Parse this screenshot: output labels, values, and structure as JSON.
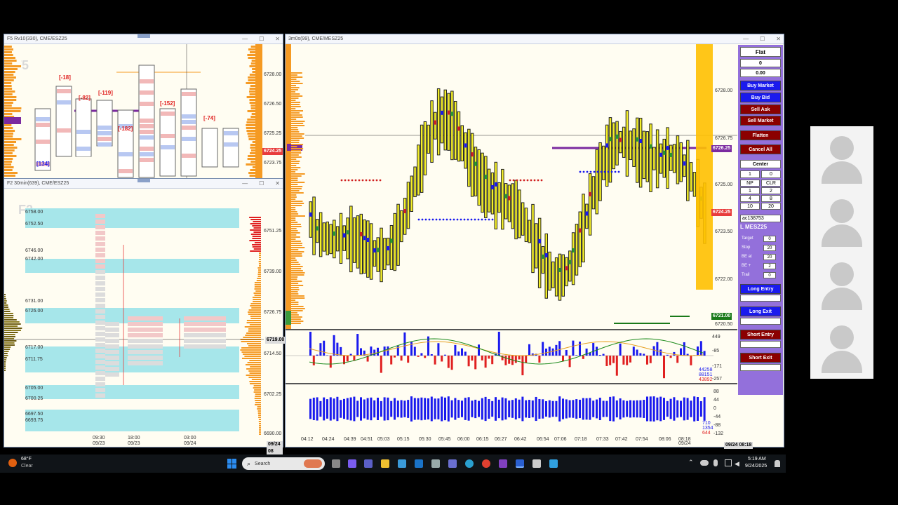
{
  "windows": {
    "f5": {
      "title": "F5 Rv10(330), CME/ESZ25",
      "label": "F5",
      "prices": [
        "6728.00",
        "6726.50",
        "6725.25",
        "6723.75"
      ],
      "current": "6724.25",
      "deltas": [
        "[-18]",
        "[-82]",
        "[-119]",
        "[-182]",
        "[-152]",
        "[-74]",
        "[134]"
      ]
    },
    "f2": {
      "title": "F2 30min(639), CME/ESZ25",
      "label": "F2",
      "levels": [
        "6758.00",
        "6752.50",
        "6746.00",
        "6742.00",
        "6731.00",
        "6726.00",
        "6717.00",
        "6711.75",
        "6705.00",
        "6700.25",
        "6697.50",
        "6693.75"
      ],
      "axis": [
        "6751.25",
        "6739.00",
        "6726.75",
        "6714.50",
        "6702.25",
        "6690.00"
      ],
      "current": "6719.00",
      "times": [
        {
          "t": "09:30",
          "d": "09/23"
        },
        {
          "t": "18:00",
          "d": "09/23"
        },
        {
          "t": "03:00",
          "d": "09/24"
        }
      ],
      "corner": "09/24 08"
    },
    "main": {
      "title": "3m0s(99), CME/MESZ25",
      "prices": [
        "6728.00",
        "6726.75",
        "6726.25",
        "6725.00",
        "6724.25",
        "6723.50",
        "6722.00",
        "6721.00",
        "6720.50"
      ],
      "times": [
        "04:12",
        "04:24",
        "04:39",
        "04:51",
        "05:03",
        "05:15",
        "05:30",
        "05:45",
        "06:00",
        "06:15",
        "06:27",
        "06:42",
        "06:54",
        "07:06",
        "07:18",
        "07:33",
        "07:42",
        "07:54",
        "08:06",
        "08:18"
      ],
      "last_date": "09/24",
      "corner": "09/24 08:18",
      "delta_axis": [
        "449",
        "-85",
        "-171",
        "-257"
      ],
      "delta_vals": [
        "44258",
        "88151",
        "43892"
      ],
      "vol_axis": [
        "88",
        "44",
        "0",
        "-44",
        "-88",
        "-132"
      ],
      "vol_vals": [
        "710",
        "1354",
        "644"
      ]
    }
  },
  "order_panel": {
    "position": "Flat",
    "qty": "0",
    "pnl": "0.00",
    "buy_market": "Buy Market",
    "buy_bid": "Buy Bid",
    "sell_ask": "Sell Ask",
    "sell_market": "Sell Market",
    "flatten": "Flatten",
    "cancel_all": "Cancel All",
    "center": "Center",
    "qty_input": "1",
    "qty_right": "0",
    "grid": [
      "NP",
      "CLR",
      "1",
      "2",
      "4",
      "8",
      "10",
      "20"
    ],
    "account": "ac138753",
    "instrument": "L MESZ25",
    "target_label": "Target",
    "target": "0",
    "stop_label": "Stop",
    "stop": "20",
    "be_at_label": "BE at",
    "be_at": "20",
    "be_plus_label": "BE +",
    "be_plus": "2",
    "trail_label": "Trail",
    "trail": "0",
    "long_entry": "Long Entry",
    "long_exit": "Long Exit",
    "short_entry": "Short Entry",
    "short_exit": "Short Exit"
  },
  "taskbar": {
    "temp": "68°F",
    "weather": "Clear",
    "search": "Search",
    "time": "5:19 AM",
    "date": "9/24/2025"
  },
  "colors": {
    "accent_blue": "#1a1aee",
    "sell_red": "#8b0000",
    "panel": "#9370db",
    "yellow": "#f4ef2a",
    "orange": "#f59a23"
  }
}
